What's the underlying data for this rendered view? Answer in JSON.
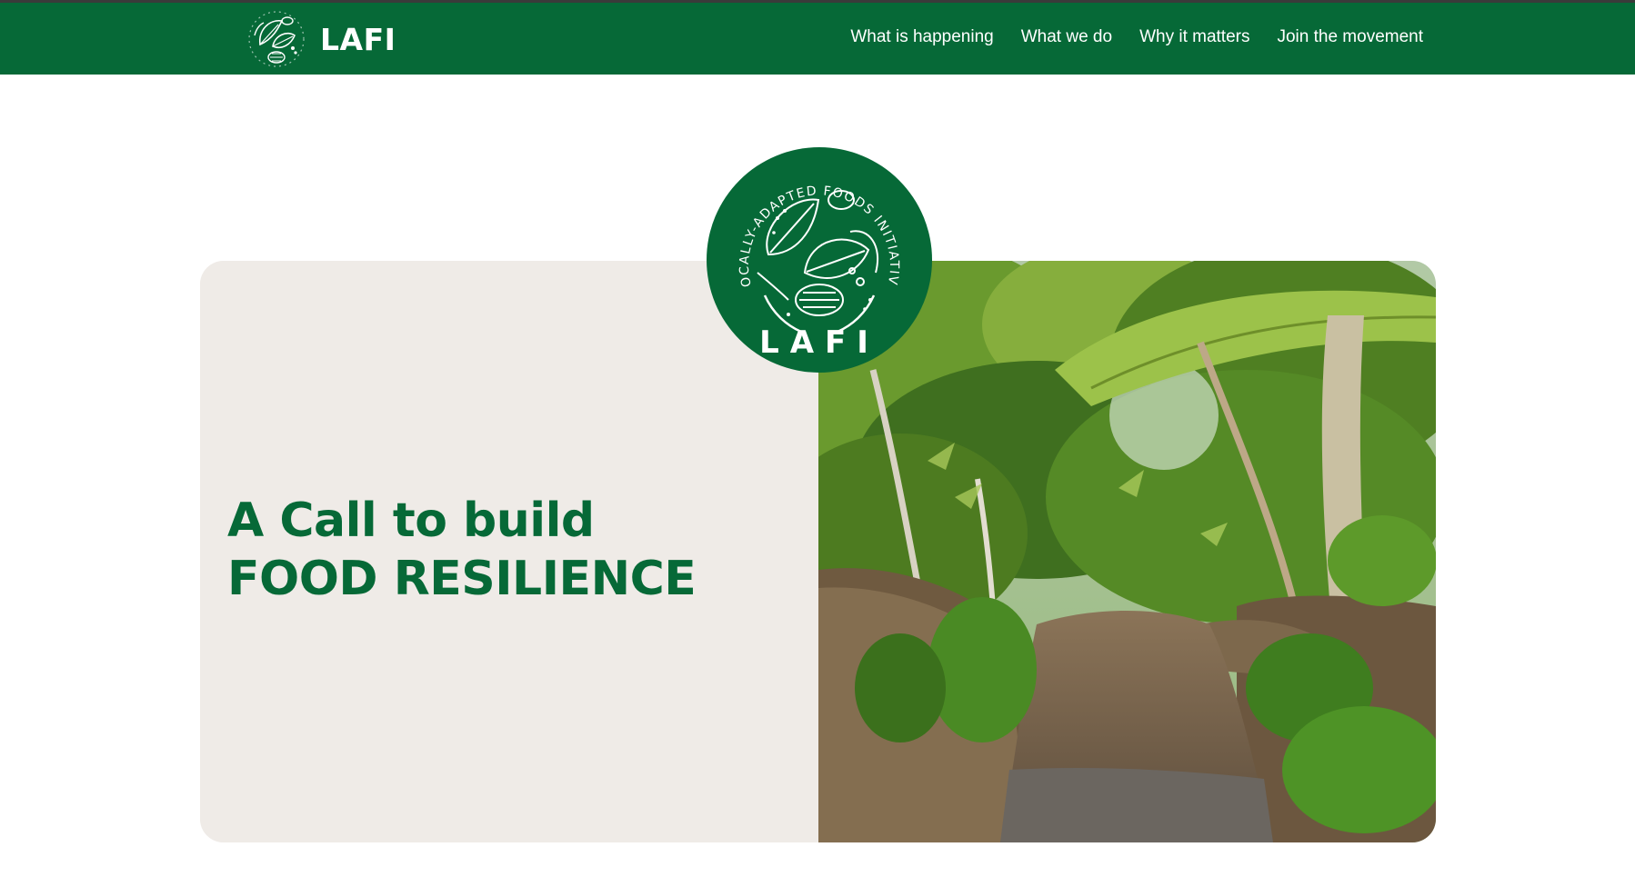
{
  "header": {
    "brand_name": "LAFI",
    "nav": [
      "What is happening",
      "What we do",
      "Why it matters",
      "Join the movement"
    ]
  },
  "hero": {
    "headline_line1": "A Call to build",
    "headline_line2": "FOOD RESILIENCE",
    "emblem": {
      "ring_text": "LOCALLY-ADAPTED FOODS INITIATIVE",
      "center_text": "LAFI"
    },
    "photo": "garden-path-photo"
  },
  "colors": {
    "brand_green": "#066937",
    "panel_beige": "#efebe7",
    "white": "#ffffff"
  }
}
